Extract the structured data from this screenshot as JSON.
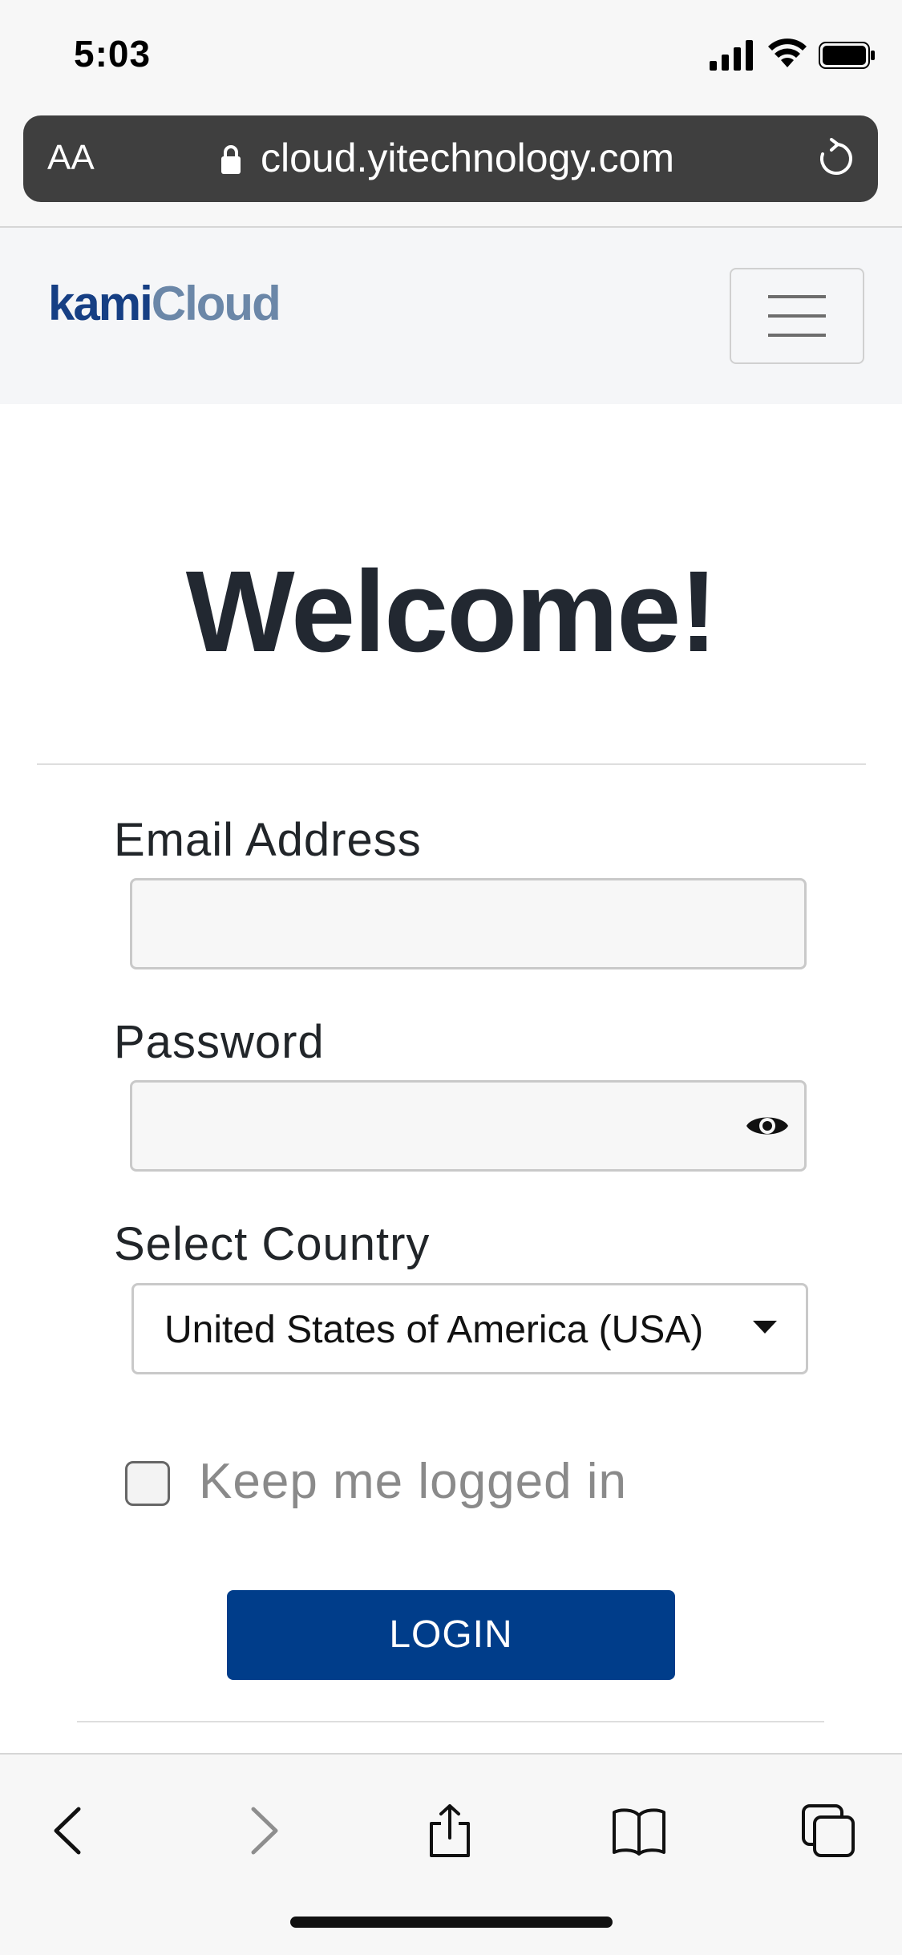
{
  "status_bar": {
    "time": "5:03",
    "icons": [
      "signal-icon",
      "wifi-icon",
      "battery-icon"
    ]
  },
  "browser": {
    "text_size_button": "AA",
    "url": "cloud.yitechnology.com",
    "icons": [
      "lock-icon",
      "reload-icon"
    ]
  },
  "site_nav": {
    "logo_part1": "kami",
    "logo_part2": "Cloud",
    "menu_icon": "hamburger-menu-icon"
  },
  "login_form": {
    "title": "Welcome!",
    "email_label": "Email Address",
    "email_value": "",
    "password_label": "Password",
    "password_value": "",
    "country_label": "Select Country",
    "country_selected": "United States of America (USA)",
    "keep_logged_in_label": "Keep me logged in",
    "keep_logged_in_checked": false,
    "login_button": "LOGIN"
  },
  "toolbar": {
    "icons": [
      "back-icon",
      "forward-icon",
      "share-icon",
      "bookmarks-icon",
      "tabs-icon"
    ]
  },
  "colors": {
    "brand_primary": "#003d8a",
    "logo_dark": "#163f84",
    "logo_light": "#6b87a8",
    "url_bar_bg": "#3f3f3f"
  }
}
